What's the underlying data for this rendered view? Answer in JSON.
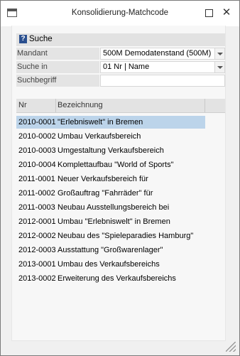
{
  "window": {
    "title": "Konsolidierung-Matchcode"
  },
  "search": {
    "title": "Suche",
    "mandant_label": "Mandant",
    "mandant_value": "500M Demodatenstand (500M)",
    "suche_in_label": "Suche in",
    "suche_in_value": "01 Nr | Name",
    "suchbegriff_label": "Suchbegriff",
    "suchbegriff_value": ""
  },
  "list": {
    "columns": [
      "Nr",
      "Bezeichnung"
    ],
    "selected_index": 0,
    "rows": [
      {
        "nr": "2010-0001",
        "bez": "\"Erlebniswelt\" in Bremen"
      },
      {
        "nr": "2010-0002",
        "bez": "Umbau Verkaufsbereich"
      },
      {
        "nr": "2010-0003",
        "bez": "Umgestaltung Verkaufsbereich"
      },
      {
        "nr": "2010-0004",
        "bez": "Komplettaufbau \"World of Sports\""
      },
      {
        "nr": "2011-0001",
        "bez": "Neuer Verkaufsbereich für"
      },
      {
        "nr": "2011-0002",
        "bez": "Großauftrag \"Fahrräder\" für"
      },
      {
        "nr": "2011-0003",
        "bez": "Neubau Ausstellungsbereich bei"
      },
      {
        "nr": "2012-0001",
        "bez": "Umbau \"Erlebniswelt\" in Bremen"
      },
      {
        "nr": "2012-0002",
        "bez": "Neubau des \"Spieleparadies Hamburg\""
      },
      {
        "nr": "2012-0003",
        "bez": "Ausstattung \"Großwarenlager\""
      },
      {
        "nr": "2013-0001",
        "bez": "Umbau des Verkaufsbereichs"
      },
      {
        "nr": "2013-0002",
        "bez": "Erweiterung des Verkaufsbereichs"
      }
    ]
  }
}
